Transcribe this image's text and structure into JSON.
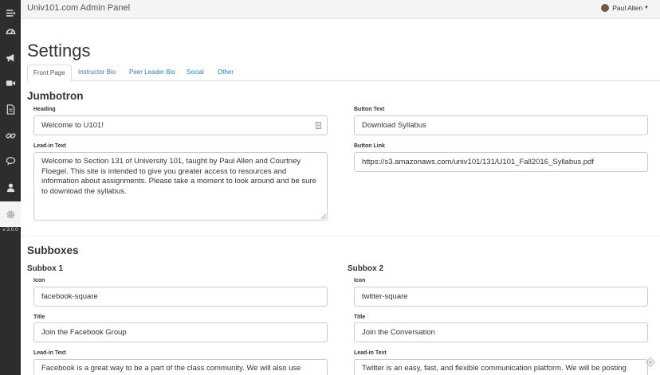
{
  "app": {
    "title": "Univ101.com Admin Panel",
    "version": "v 3.0.0"
  },
  "user": {
    "name": "Paul Allen"
  },
  "sidebar": {
    "items": [
      {
        "icon": "menu-icon"
      },
      {
        "icon": "dashboard-icon"
      },
      {
        "icon": "bullhorn-icon"
      },
      {
        "icon": "video-icon"
      },
      {
        "icon": "document-icon"
      },
      {
        "icon": "link-icon"
      },
      {
        "icon": "comment-icon"
      },
      {
        "icon": "user-icon"
      },
      {
        "icon": "gear-icon",
        "active": true
      }
    ]
  },
  "page": {
    "title": "Settings"
  },
  "tabs": [
    {
      "label": "Front Page",
      "active": true
    },
    {
      "label": "Instructor Bio"
    },
    {
      "label": "Peer Leader Bio"
    },
    {
      "label": "Social"
    },
    {
      "label": "Other"
    }
  ],
  "jumbotron": {
    "title": "Jumbotron",
    "heading_label": "Heading",
    "heading_value": "Welcome to U101!",
    "leadin_label": "Lead-in Text",
    "leadin_value": "Welcome to Section 131 of University 101, taught by Paul Allen and Courtney Floegel. This site is intended to give you greater access to resources and information about assignments. Please take a moment to look around and be sure to download the syllabus.",
    "button_text_label": "Button Text",
    "button_text_value": "Download Syllabus",
    "button_link_label": "Button Link",
    "button_link_value": "https://s3.amazonaws.com/univ101/131/U101_Fall2016_Syllabus.pdf"
  },
  "subboxes": {
    "title": "Subboxes",
    "box1": {
      "title": "Subbox 1",
      "icon_label": "Icon",
      "icon_value": "facebook-square",
      "title_label": "Title",
      "title_value": "Join the Facebook Group",
      "leadin_label": "Lead-in Text",
      "leadin_value": "Facebook is a great way to be a part of the class community. We will also use"
    },
    "box2": {
      "title": "Subbox 2",
      "icon_label": "Icon",
      "icon_value": "twitter-square",
      "title_label": "Title",
      "title_value": "Join the Conversation",
      "leadin_label": "Lead-in Text",
      "leadin_value": "Twitter is an easy, fast, and flexible communication platform. We will be posting"
    }
  }
}
